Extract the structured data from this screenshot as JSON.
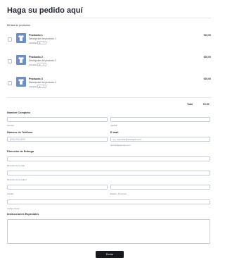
{
  "page": {
    "title": "Haga su pedido aquí"
  },
  "products": {
    "section_label": "Mi lista de productos",
    "items": [
      {
        "name": "Producto 1",
        "description": "Descripción del producto 1",
        "quantity_label": "Cantidad",
        "quantity": "1",
        "price": "€10,00"
      },
      {
        "name": "Producto 2",
        "description": "Descripción del producto 2",
        "quantity_label": "Cantidad",
        "quantity": "1",
        "price": "€20,00"
      },
      {
        "name": "Producto 3",
        "description": "Descripción del producto 3",
        "quantity_label": "Cantidad",
        "quantity": "1",
        "price": "€30,00"
      }
    ],
    "total_label": "Total",
    "total_value": "€0,00"
  },
  "form": {
    "full_name": {
      "label": "Nombre Completo",
      "first_sublabel": "Nombre",
      "last_sublabel": "Apellido",
      "first_value": "",
      "last_value": ""
    },
    "phone": {
      "label": "Número de Teléfono",
      "placeholder": "(000) 000-0000"
    },
    "email": {
      "label": "E-mail",
      "placeholder": "ej.: myname@example.com",
      "sublabel": "ejemplo@ejemplo.com"
    },
    "address": {
      "label": "Dirección de Entrega",
      "street_sublabel": "Dirección de la calle",
      "street2_sublabel": "Dirección de la Calle 2",
      "city_sublabel": "Ciudad",
      "state_sublabel": "Estado / Provincia",
      "zip_sublabel": "Código Postal"
    },
    "instructions": {
      "label": "Instrucciones Especiales",
      "value": ""
    },
    "submit_label": "Enviar"
  },
  "colors": {
    "thumbnail": "#6d8fc7",
    "submit_bg": "#17191e"
  },
  "icons": {
    "product_thumbnail": "tshirt-icon",
    "quantity_caret": "chevron-down-icon"
  }
}
